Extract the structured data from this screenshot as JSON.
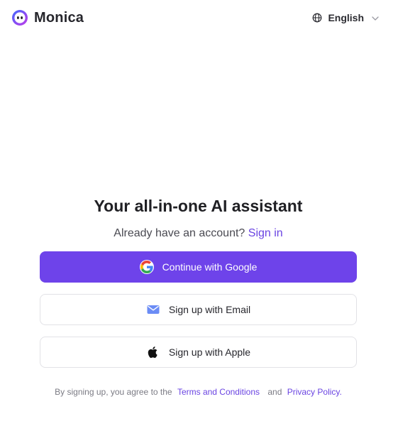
{
  "header": {
    "brand_name": "Monica",
    "language_label": "English"
  },
  "main": {
    "title": "Your all-in-one AI assistant",
    "subtitle_text": "Already have an account?",
    "signin_link": "Sign in",
    "buttons": {
      "google": "Continue with Google",
      "email": "Sign up with Email",
      "apple": "Sign up with Apple"
    },
    "terms": {
      "prefix": "By signing up, you agree to the",
      "terms_link": "Terms and Conditions",
      "conjunction": "and",
      "privacy_link": "Privacy Policy."
    }
  },
  "icons": {
    "brand": "monica-logo-icon",
    "language": "globe-icon",
    "dropdown": "chevron-down-icon",
    "google": "google-icon",
    "email": "mail-icon",
    "apple": "apple-icon"
  },
  "colors": {
    "accent": "#6e43ea",
    "link": "#6a44e2",
    "text": "#202024",
    "muted": "#7b7b84",
    "border": "#e2e2e6"
  }
}
